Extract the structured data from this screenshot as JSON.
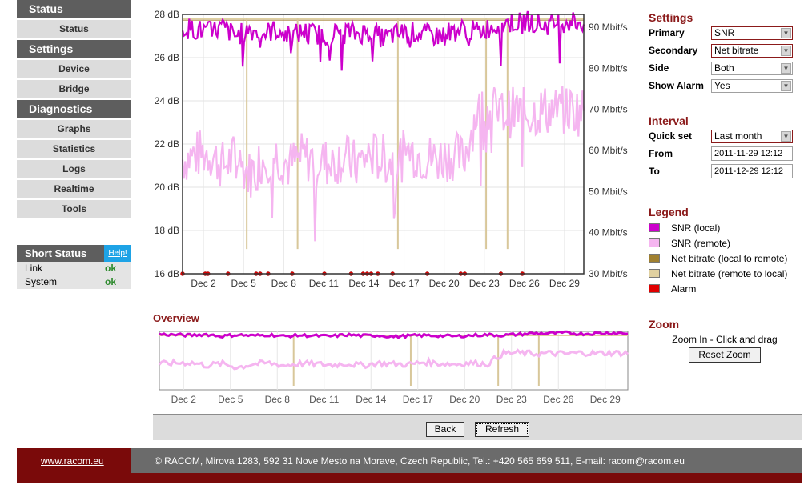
{
  "sidebar": [
    {
      "type": "head",
      "label": "Status"
    },
    {
      "type": "item",
      "label": "Status"
    },
    {
      "type": "head",
      "label": "Settings"
    },
    {
      "type": "item",
      "label": "Device"
    },
    {
      "type": "item",
      "label": "Bridge"
    },
    {
      "type": "head",
      "label": "Diagnostics"
    },
    {
      "type": "item",
      "label": "Graphs"
    },
    {
      "type": "item",
      "label": "Statistics"
    },
    {
      "type": "item",
      "label": "Logs"
    },
    {
      "type": "item",
      "label": "Realtime"
    },
    {
      "type": "item",
      "label": "Tools"
    }
  ],
  "short_status": {
    "title": "Short Status",
    "help": "Help!",
    "rows": [
      {
        "label": "Link",
        "value": "ok"
      },
      {
        "label": "System",
        "value": "ok"
      }
    ]
  },
  "settings": {
    "title": "Settings",
    "fields": [
      {
        "label": "Primary",
        "value": "SNR"
      },
      {
        "label": "Secondary",
        "value": "Net bitrate"
      },
      {
        "label": "Side",
        "value": "Both"
      },
      {
        "label": "Show Alarm",
        "value": "Yes"
      }
    ]
  },
  "interval": {
    "title": "Interval",
    "quick_set_label": "Quick set",
    "quick_set_value": "Last month",
    "from_label": "From",
    "from_value": "2011-11-29 12:12",
    "to_label": "To",
    "to_value": "2011-12-29 12:12"
  },
  "legend": {
    "title": "Legend",
    "items": [
      {
        "label": "SNR (local)",
        "color": "#cc00cc"
      },
      {
        "label": "SNR (remote)",
        "color": "#f5b5f0"
      },
      {
        "label": "Net bitrate (local to remote)",
        "color": "#a08030"
      },
      {
        "label": "Net bitrate (remote to local)",
        "color": "#e0d0a0"
      },
      {
        "label": "Alarm",
        "color": "#e00000"
      }
    ]
  },
  "zoom": {
    "title": "Zoom",
    "hint": "Zoom In - Click and drag",
    "reset_label": "Reset Zoom"
  },
  "overview_title": "Overview",
  "buttons": {
    "back": "Back",
    "refresh": "Refresh"
  },
  "footer": {
    "link": "www.racom.eu",
    "text": "© RACOM, Mirova 1283, 592 31 Nove Mesto na Morave, Czech Republic, Tel.: +420 565 659 511, E-mail: racom@racom.eu"
  },
  "chart_data": [
    {
      "type": "line",
      "name": "main",
      "x_ticks": [
        "Dec 2",
        "Dec 5",
        "Dec 8",
        "Dec 11",
        "Dec 14",
        "Dec 17",
        "Dec 20",
        "Dec 23",
        "Dec 26",
        "Dec 29"
      ],
      "y_left_ticks": [
        "16 dB",
        "18 dB",
        "20 dB",
        "22 dB",
        "24 dB",
        "26 dB",
        "28 dB"
      ],
      "y_right_ticks": [
        "30 Mbit/s",
        "40 Mbit/s",
        "50 Mbit/s",
        "60 Mbit/s",
        "70 Mbit/s",
        "80 Mbit/s",
        "90 Mbit/s"
      ],
      "x_range_days": [
        0,
        30
      ],
      "y_left_range": [
        16,
        28
      ],
      "y_right_range": [
        30,
        93
      ],
      "grid": true,
      "series": [
        {
          "name": "SNR (local)",
          "color": "#cc00cc",
          "x": [
            0,
            1,
            2,
            3,
            4,
            5,
            6,
            7,
            8,
            9,
            10,
            11,
            12,
            13,
            14,
            15,
            16,
            17,
            18,
            19,
            20,
            21,
            22,
            23,
            24,
            25,
            26,
            27,
            28,
            29,
            30
          ],
          "y": [
            27.4,
            27.3,
            27.2,
            27.4,
            27.0,
            27.3,
            27.1,
            27.3,
            27.0,
            27.2,
            27.1,
            27.0,
            27.3,
            27.1,
            27.2,
            26.9,
            27.1,
            27.2,
            27.1,
            27.0,
            27.2,
            27.3,
            27.2,
            27.4,
            27.6,
            27.6,
            27.7,
            27.5,
            27.6,
            27.7,
            27.6
          ]
        },
        {
          "name": "SNR (remote)",
          "color": "#f5b5f0",
          "x": [
            0,
            1,
            2,
            3,
            4,
            5,
            6,
            7,
            8,
            9,
            10,
            11,
            12,
            13,
            14,
            15,
            16,
            17,
            18,
            19,
            20,
            21,
            22,
            23,
            24,
            25,
            26,
            27,
            28,
            29,
            30
          ],
          "y": [
            21.3,
            21.5,
            21.6,
            21.0,
            21.4,
            20.6,
            21.3,
            21.5,
            21.0,
            21.4,
            21.3,
            21.1,
            21.4,
            21.0,
            21.5,
            21.3,
            21.2,
            21.7,
            21.4,
            21.3,
            21.5,
            21.3,
            23.5,
            23.6,
            23.4,
            23.5,
            23.4,
            23.6,
            23.5,
            23.6,
            23.5
          ]
        },
        {
          "name": "Net bitrate (remote to local)",
          "color": "#e0d0a0",
          "x": [
            0,
            30
          ],
          "y": [
            92,
            92
          ]
        },
        {
          "name": "Net bitrate (local to remote)",
          "color": "#a08030",
          "x": [
            0,
            30
          ],
          "y": [
            92,
            92
          ]
        }
      ]
    },
    {
      "type": "line",
      "name": "overview",
      "x_ticks": [
        "Dec 2",
        "Dec 5",
        "Dec 8",
        "Dec 11",
        "Dec 14",
        "Dec 17",
        "Dec 20",
        "Dec 23",
        "Dec 26",
        "Dec 29"
      ],
      "x_range_days": [
        0,
        30
      ]
    }
  ]
}
